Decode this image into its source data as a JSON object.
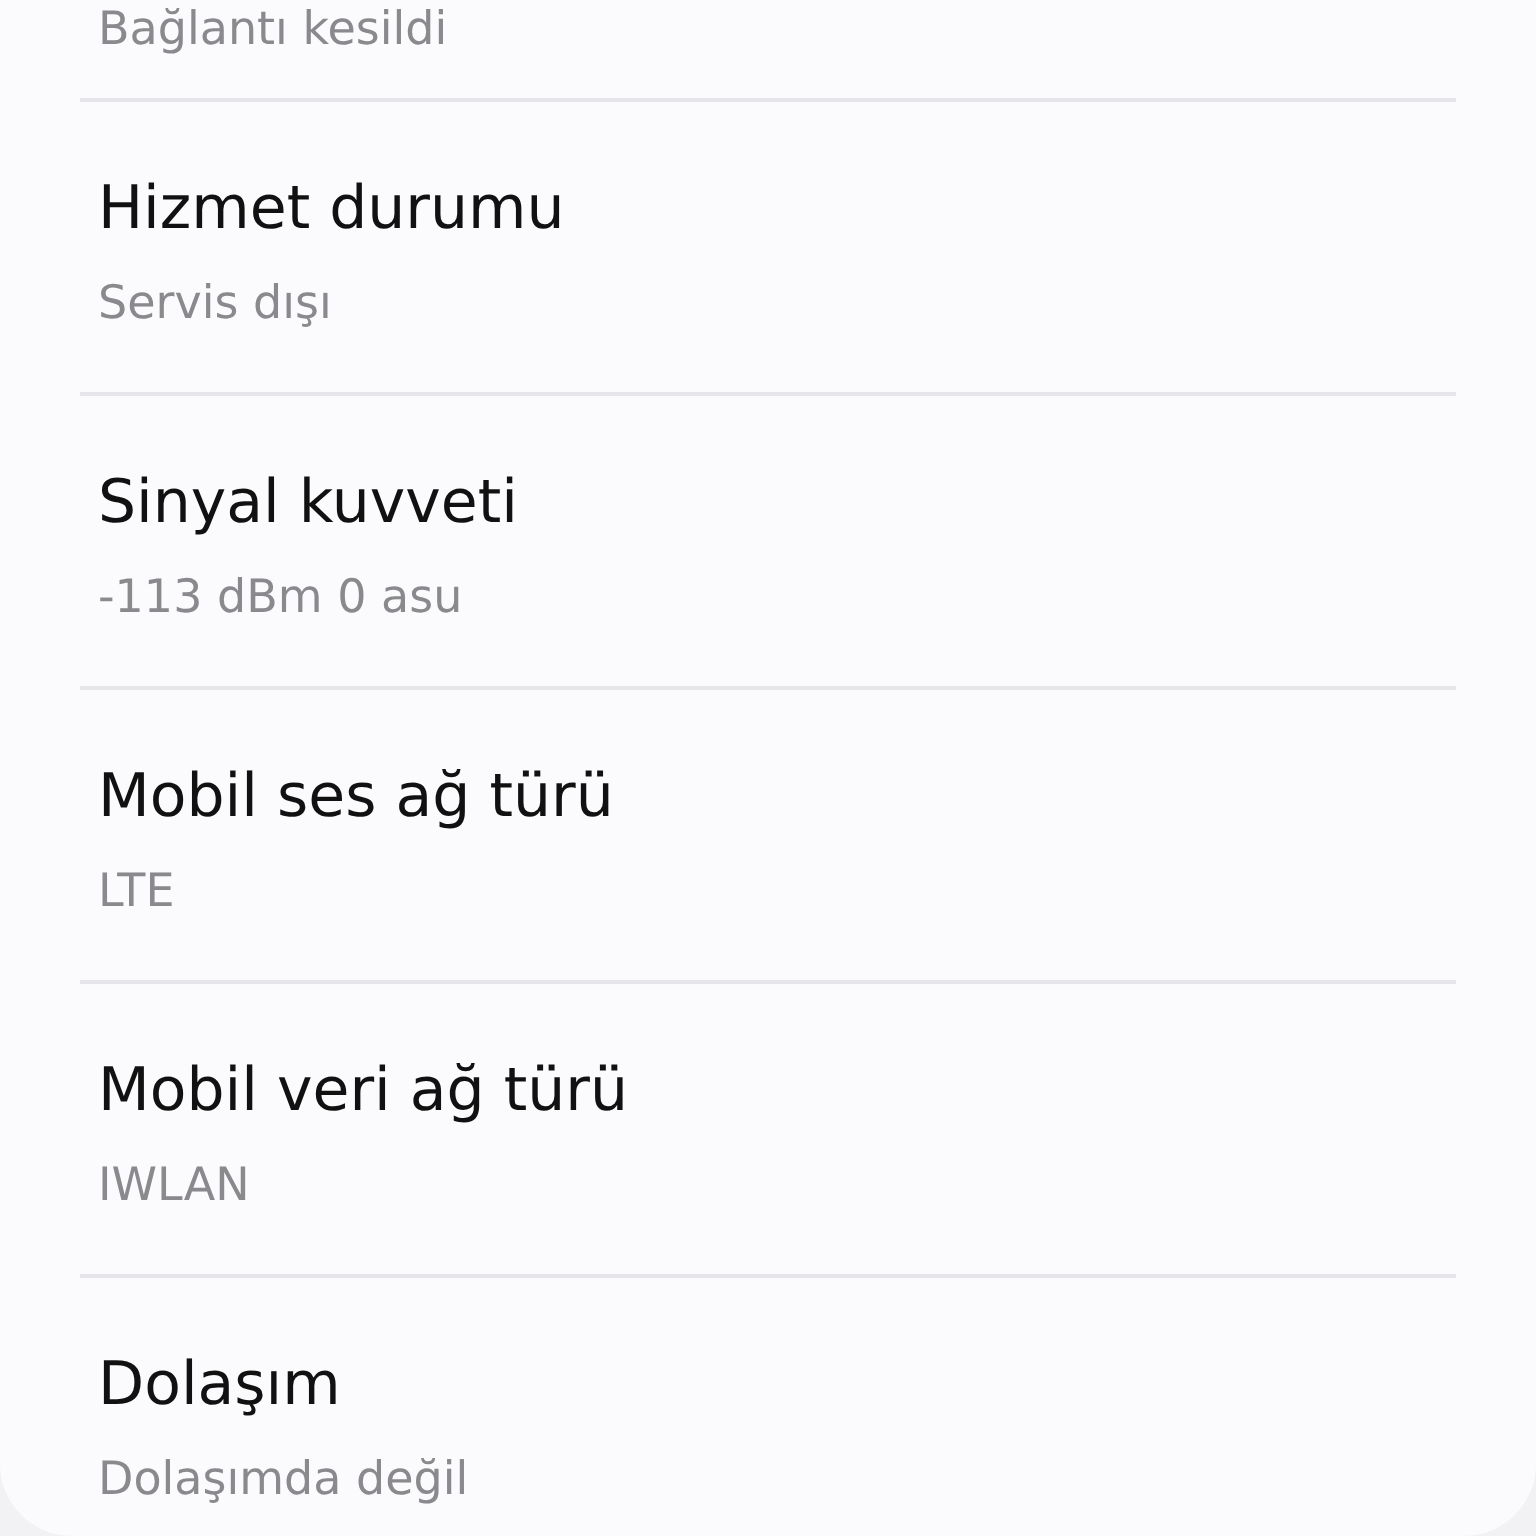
{
  "top_item": {
    "subtitle": "Bağlantı kesildi"
  },
  "items": [
    {
      "title": "Hizmet durumu",
      "subtitle": "Servis dışı"
    },
    {
      "title": "Sinyal kuvveti",
      "subtitle": "-113 dBm 0 asu"
    },
    {
      "title": "Mobil ses ağ türü",
      "subtitle": "LTE"
    },
    {
      "title": "Mobil veri ağ türü",
      "subtitle": "IWLAN"
    },
    {
      "title": "Dolaşım",
      "subtitle": "Dolaşımda değil"
    }
  ]
}
